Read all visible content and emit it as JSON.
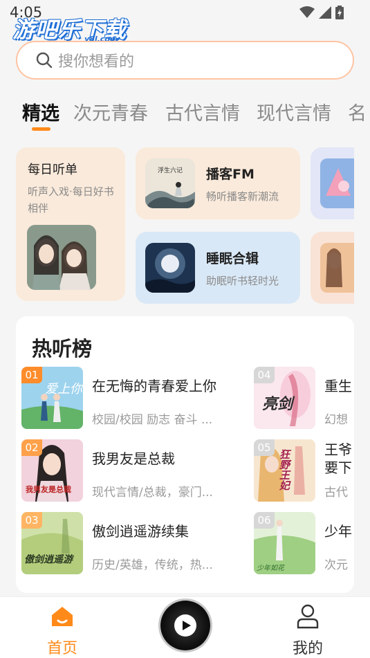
{
  "status_bar": {
    "time": "4:05"
  },
  "watermark": {
    "text": "游吧乐下载",
    "sub": "y8l.com"
  },
  "search": {
    "placeholder": "搜你想看的"
  },
  "tabs": [
    "精选",
    "次元青春",
    "古代言情",
    "现代言情",
    "名"
  ],
  "active_tab": "精选",
  "cards": {
    "daily": {
      "title": "每日听单",
      "desc": "听声入戏·每日好书相伴"
    },
    "podcast": {
      "title": "播客FM",
      "desc": "畅听播客新潮流",
      "cover_text": "浮生六记"
    },
    "sleep": {
      "title": "睡眠合辑",
      "desc": "助眠听书轻时光"
    }
  },
  "ranking": {
    "title": "热听榜",
    "items": [
      {
        "rank": "01",
        "name": "在无悔的青春爱上你",
        "tags": "校园/校园 励志 奋斗 ...",
        "cover_text": "爱上你"
      },
      {
        "rank": "02",
        "name": "我男友是总裁",
        "tags": "现代言情/总裁，豪门...",
        "cover_text": "我男友是总裁"
      },
      {
        "rank": "03",
        "name": "傲剑逍遥游续集",
        "tags": "历史/英雄，传统，热...",
        "cover_text": "傲剑逍遥游"
      },
      {
        "rank": "04",
        "name": "重生",
        "tags": "幻想",
        "cover_text": "亮剑"
      },
      {
        "rank": "05",
        "name": "王爷要下",
        "tags": "古代",
        "cover_text": "狂野王妃"
      },
      {
        "rank": "06",
        "name": "少年",
        "tags": "次元",
        "cover_text": "少年如花"
      }
    ]
  },
  "bottom_nav": {
    "home": "首页",
    "mine": "我的"
  },
  "colors": {
    "accent": "#ff8a1a",
    "rank_badge": "#ff8c2a",
    "search_border": "#ffc3a3"
  }
}
